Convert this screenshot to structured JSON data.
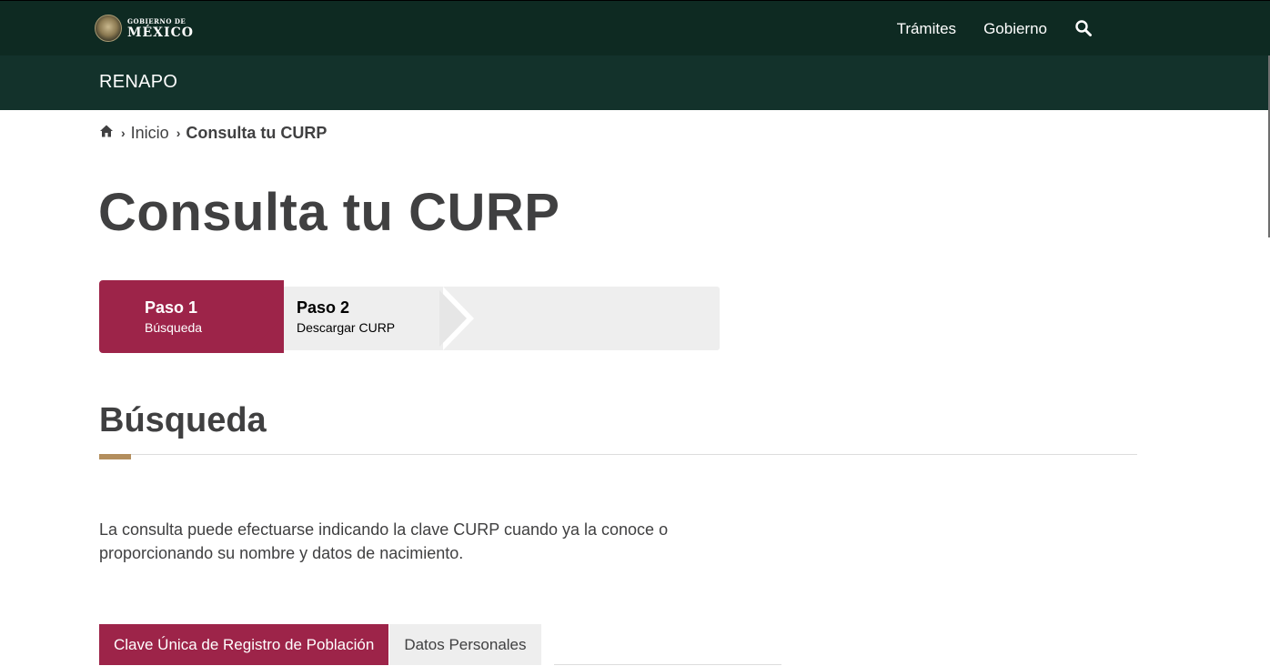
{
  "header": {
    "logo_small": "GOBIERNO DE",
    "logo_big": "MÉXICO",
    "nav": [
      "Trámites",
      "Gobierno"
    ],
    "search_icon": "search-icon"
  },
  "subheader": {
    "title": "RENAPO"
  },
  "breadcrumb": {
    "home_icon": "home-icon",
    "items": [
      "Inicio",
      "Consulta tu CURP"
    ]
  },
  "page": {
    "title": "Consulta tu CURP"
  },
  "stepper": {
    "steps": [
      {
        "num": "Paso 1",
        "desc": "Búsqueda",
        "active": true
      },
      {
        "num": "Paso 2",
        "desc": "Descargar CURP",
        "active": false
      }
    ]
  },
  "section": {
    "title": "Búsqueda",
    "intro": "La consulta puede efectuarse indicando la clave CURP cuando ya la conoce o proporcionando su nombre y datos de nacimiento."
  },
  "tabs": [
    {
      "label": "Clave Única de Registro de Población",
      "active": true
    },
    {
      "label": "Datos Personales",
      "active": false
    }
  ],
  "colors": {
    "header_bg": "#0e2a22",
    "subheader_bg": "#13322b",
    "accent_red": "#9d2449",
    "accent_gold": "#b38e5d"
  }
}
